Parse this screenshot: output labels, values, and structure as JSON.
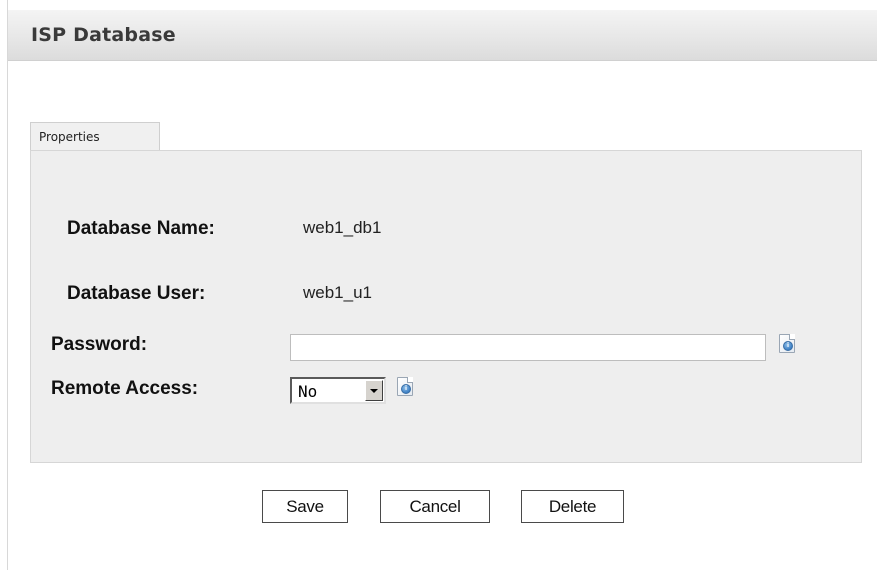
{
  "header": {
    "title": "ISP Database"
  },
  "tabs": [
    {
      "label": "Properties"
    }
  ],
  "form": {
    "database_name": {
      "label": "Database Name:",
      "value": "web1_db1"
    },
    "database_user": {
      "label": "Database User:",
      "value": "web1_u1"
    },
    "password": {
      "label": "Password:",
      "value": "",
      "placeholder": ""
    },
    "remote_access": {
      "label": "Remote Access:",
      "selected": "No"
    }
  },
  "buttons": {
    "save": "Save",
    "cancel": "Cancel",
    "delete": "Delete"
  },
  "icons": {
    "password_help": "info-icon",
    "remote_access_help": "info-icon"
  },
  "colors": {
    "header_bg": "#e6e6e6",
    "panel_bg": "#eeeeee",
    "tab_bg": "#f0f0f0"
  }
}
